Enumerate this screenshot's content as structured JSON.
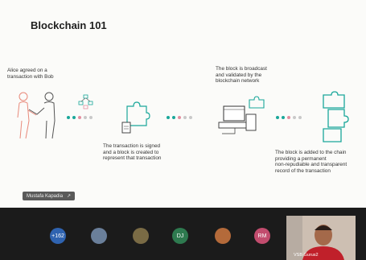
{
  "slide": {
    "title": "Blockchain 101",
    "captions": {
      "alice": [
        "Alice agreed on a",
        "transaction with Bob"
      ],
      "signed": [
        "The transaction is signed",
        "and a block is created to",
        "represent that transaction"
      ],
      "broadcast": [
        "The block is broadcast",
        "and validated by the",
        "blockchain network"
      ],
      "added": [
        "The block is added to the chain",
        "providing a permanent",
        "non-repudiable and transparent",
        "record of the transaction"
      ]
    },
    "dot_colors": [
      "#1aa79a",
      "#1aa79a",
      "#e58fa0",
      "#c9c9c9",
      "#c9c9c9"
    ],
    "accent_color": "#1aa79a",
    "speaker_label": "Mustafa Kapadia"
  },
  "participants": [
    {
      "label": "+162",
      "color": "#2f63b0",
      "icon": "count-badge"
    },
    {
      "label": "",
      "color": "#6a7f9a",
      "icon": "avatar-photo"
    },
    {
      "label": "",
      "color": "#7a6b45",
      "icon": "avatar-photo"
    },
    {
      "label": "DJ",
      "color": "#2e7a4f",
      "icon": "initials"
    },
    {
      "label": "",
      "color": "#b46a3a",
      "icon": "avatar-photo"
    },
    {
      "label": "RM",
      "color": "#c24c6e",
      "icon": "initials"
    }
  ],
  "video_tile": {
    "name": "VSB Gurus2"
  }
}
